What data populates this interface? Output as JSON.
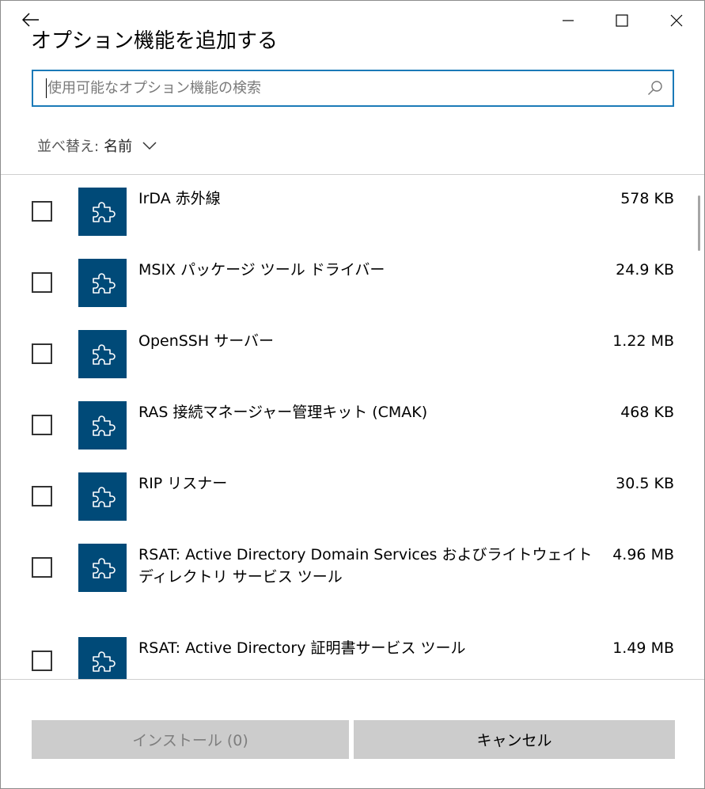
{
  "window": {
    "title": "オプション機能を追加する"
  },
  "search": {
    "placeholder": "使用可能なオプション機能の検索"
  },
  "sort": {
    "label": "並べ替え:",
    "value": "名前"
  },
  "features": [
    {
      "name": "IrDA 赤外線",
      "size": "578 KB"
    },
    {
      "name": "MSIX パッケージ ツール ドライバー",
      "size": "24.9 KB"
    },
    {
      "name": "OpenSSH サーバー",
      "size": "1.22 MB"
    },
    {
      "name": "RAS 接続マネージャー管理キット (CMAK)",
      "size": "468 KB"
    },
    {
      "name": "RIP リスナー",
      "size": "30.5 KB"
    },
    {
      "name": "RSAT: Active Directory Domain Services およびライトウェイト ディレクトリ サービス ツール",
      "size": "4.96 MB"
    },
    {
      "name": "RSAT: Active Directory 証明書サービス ツール",
      "size": "1.49 MB"
    }
  ],
  "buttons": {
    "install": "インストール (0)",
    "cancel": "キャンセル"
  },
  "colors": {
    "accent": "#1b7ab8",
    "tile": "#004a78",
    "button_bg": "#cccccc",
    "disabled_text": "#7e7e7e"
  },
  "icons": {
    "back": "arrow-left-icon",
    "minimize": "minimize-icon",
    "maximize": "maximize-icon",
    "close": "close-icon",
    "search": "search-icon",
    "sort": "chevron-down-icon",
    "feature": "puzzle-piece-icon"
  }
}
